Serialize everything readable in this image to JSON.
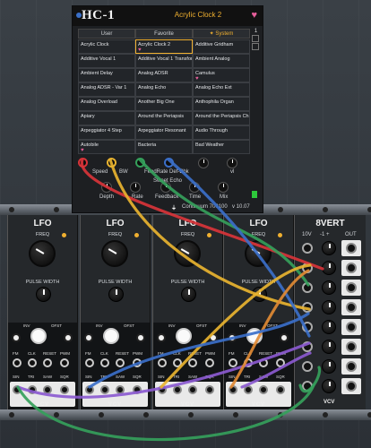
{
  "hc1": {
    "logo": "HC-1",
    "current_preset": "Acrylic Clock 2",
    "columns": [
      "User",
      "Favorite",
      "System"
    ],
    "active_column": 2,
    "presets": [
      [
        "Acrylic Clock",
        "Acrylic Clock 2",
        "Additive Gridham"
      ],
      [
        "Additive Vocal 1",
        "Additive Vocal 1 Transfor",
        "Ambient Analog"
      ],
      [
        "Ambient Delay",
        "Analog ADSR",
        "Camulus"
      ],
      [
        "Analog ADSR - Var 1",
        "Analog Echo",
        "Analog Echo Ext"
      ],
      [
        "Analog Overload",
        "Another Big One",
        "Anthophila Organ"
      ],
      [
        "Apiary",
        "Around the Periapsis",
        "Around the Periapsis Ch"
      ],
      [
        "Arpeggiator 4 Step",
        "Arpeggiator Resonant",
        "Audio Through"
      ],
      [
        "Autobile",
        "Bacteria",
        "Bad Weather"
      ]
    ],
    "favorites": [
      "Acrylic Clock 2",
      "Camulus",
      "Autobile"
    ],
    "page_label": "1",
    "controls": [
      "Speed",
      "BW",
      "FeedRate",
      "Def-Bbk",
      "",
      "vl"
    ],
    "sweet_echo_label": "Sweet Echo",
    "bottom_labels": [
      "Depth",
      "Rate",
      "Feedback",
      "Time",
      "Mix"
    ],
    "footer": "Continuum 700100",
    "version": "v 10.07"
  },
  "lfo_modules": [
    {
      "title": "LFO",
      "freq": "FREQ",
      "pulse_width": "PULSE WIDTH",
      "inv": "INV",
      "ofst": "OFST",
      "inputs": [
        "FM",
        "CLK",
        "RESET",
        "PWM"
      ],
      "outputs": [
        "SIN",
        "TRI",
        "SAW",
        "SQR"
      ],
      "brand": "VCV"
    },
    {
      "title": "LFO",
      "freq": "FREQ",
      "pulse_width": "PULSE WIDTH",
      "inv": "INV",
      "ofst": "OFST",
      "inputs": [
        "FM",
        "CLK",
        "RESET",
        "PWM"
      ],
      "outputs": [
        "SIN",
        "TRI",
        "SAW",
        "SQR"
      ],
      "brand": "VCV"
    },
    {
      "title": "LFO",
      "freq": "FREQ",
      "pulse_width": "PULSE WIDTH",
      "inv": "INV",
      "ofst": "OFST",
      "inputs": [
        "FM",
        "CLK",
        "RESET",
        "PWM"
      ],
      "outputs": [
        "SIN",
        "TRI",
        "SAW",
        "SQR"
      ],
      "brand": "VCV"
    },
    {
      "title": "LFO",
      "freq": "FREQ",
      "pulse_width": "PULSE WIDTH",
      "inv": "INV",
      "ofst": "OFST",
      "inputs": [
        "FM",
        "CLK",
        "RESET",
        "PWM"
      ],
      "outputs": [
        "SIN",
        "TRI",
        "SAW",
        "SQR"
      ],
      "brand": "VCV"
    }
  ],
  "vert": {
    "title": "8VERT",
    "scale_label": "10V",
    "range_label": "-1 +",
    "out_label": "OUT",
    "brand": "VCV"
  },
  "colors": {
    "accent": "#f0b030",
    "favorite": "#e65e9a",
    "cable_red": "#d8343a",
    "cable_yellow": "#e8b330",
    "cable_green": "#35a05b",
    "cable_blue": "#3b6fc9",
    "cable_purple": "#8b5ad0",
    "cable_orange": "#e08a34"
  }
}
